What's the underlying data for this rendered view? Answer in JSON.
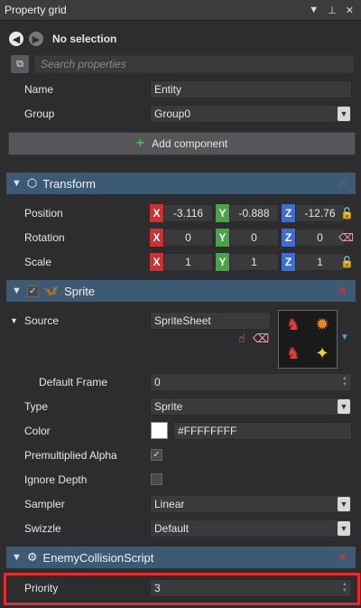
{
  "window": {
    "title": "Property grid",
    "dropdown_icon": "chevron-down-icon",
    "pin_icon": "pin-icon",
    "close_icon": "close-icon"
  },
  "nav": {
    "title": "No selection"
  },
  "search": {
    "placeholder": "Search properties"
  },
  "entity": {
    "name_label": "Name",
    "name_value": "Entity",
    "group_label": "Group",
    "group_value": "Group0"
  },
  "add_component": {
    "label": "Add component"
  },
  "transform": {
    "title": "Transform",
    "position": {
      "label": "Position",
      "x": "-3.116",
      "y": "-0.888",
      "z": "-12.76"
    },
    "rotation": {
      "label": "Rotation",
      "x": "0",
      "y": "0",
      "z": "0"
    },
    "scale": {
      "label": "Scale",
      "x": "1",
      "y": "1",
      "z": "1"
    },
    "axis_x": "X",
    "axis_y": "Y",
    "axis_z": "Z"
  },
  "sprite": {
    "title": "Sprite",
    "source_label": "Source",
    "source_value": "SpriteSheet",
    "default_frame_label": "Default Frame",
    "default_frame_value": "0",
    "type_label": "Type",
    "type_value": "Sprite",
    "color_label": "Color",
    "color_value": "#FFFFFFFF",
    "premult_label": "Premultiplied Alpha",
    "premult_checked": true,
    "ignore_depth_label": "Ignore Depth",
    "ignore_depth_checked": false,
    "sampler_label": "Sampler",
    "sampler_value": "Linear",
    "swizzle_label": "Swizzle",
    "swizzle_value": "Default"
  },
  "script": {
    "title": "EnemyCollisionScript",
    "priority_label": "Priority",
    "priority_value": "3"
  },
  "colors": {
    "section_header": "#3d5a75",
    "highlight": "#e02d2d",
    "axis_x": "#c83434",
    "axis_y": "#48a448",
    "axis_z": "#3f6ecf"
  }
}
